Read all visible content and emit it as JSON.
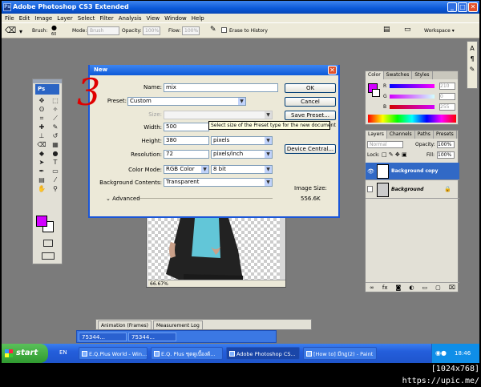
{
  "window": {
    "title": "Adobe Photoshop CS3 Extended",
    "minimize": "_",
    "maximize": "□",
    "close": "✕"
  },
  "menubar": [
    "File",
    "Edit",
    "Image",
    "Layer",
    "Select",
    "Filter",
    "Analysis",
    "View",
    "Window",
    "Help"
  ],
  "options_bar": {
    "brush_label": "Brush:",
    "brush_size": "60",
    "mode_label": "Mode:",
    "mode_value": "Brush",
    "opacity_label": "Opacity:",
    "opacity_value": "100%",
    "flow_label": "Flow:",
    "flow_value": "100%",
    "erase_history": "Erase to History",
    "workspace": "Workspace ▾"
  },
  "toolbox": {
    "badge": "Ps"
  },
  "dialog": {
    "title": "New",
    "name_label": "Name:",
    "name_value": "mix",
    "preset_label": "Preset:",
    "preset_value": "Custom",
    "size_label": "Size:",
    "width_label": "Width:",
    "width_value": "500",
    "height_label": "Height:",
    "height_value": "380",
    "height_unit": "pixels",
    "resolution_label": "Resolution:",
    "resolution_value": "72",
    "resolution_unit": "pixels/inch",
    "color_mode_label": "Color Mode:",
    "color_mode_value": "RGB Color",
    "bit_depth": "8 bit",
    "bg_label": "Background Contents:",
    "bg_value": "Transparent",
    "advanced": "Advanced",
    "ok": "OK",
    "reset": "Cancel",
    "save_preset": "Save Preset...",
    "device_central": "Device Central...",
    "image_size_label": "Image Size:",
    "image_size_value": "556.6K",
    "tooltip": "Select size of the Preset type for the new document"
  },
  "document": {
    "zoom": "66.67%"
  },
  "color_panel": {
    "tabs": [
      "Color",
      "Swatches",
      "Styles"
    ],
    "r_label": "R",
    "r_value": "210",
    "g_label": "G",
    "g_value": "0",
    "b_label": "B",
    "b_value": "255",
    "foreground": "#d200ff"
  },
  "layers_panel": {
    "tabs": [
      "Layers",
      "Channels",
      "Paths",
      "Presets"
    ],
    "blend": "Normal",
    "opacity_label": "Opacity:",
    "opacity_value": "100%",
    "lock_label": "Lock:",
    "fill_label": "Fill:",
    "fill_value": "100%",
    "layers": [
      {
        "name": "Background copy",
        "selected": true
      },
      {
        "name": "Background",
        "selected": false
      }
    ]
  },
  "bottom_panel": {
    "tabs": [
      "Animation (Frames)",
      "Measurement Log"
    ]
  },
  "task_group": [
    "75344...",
    "75344..."
  ],
  "taskbar": {
    "start": "start",
    "lang": "EN",
    "buttons": [
      "E.Q.Plus World - Win...",
      "E.Q. Plus ชุดดูเบื้องต้...",
      "Adobe Photoshop CS...",
      "[How to] มีกฎ(2) - Paint"
    ],
    "clock": "18:46"
  },
  "caption": "[1024x768] https://upic.me/",
  "annotation": "3"
}
